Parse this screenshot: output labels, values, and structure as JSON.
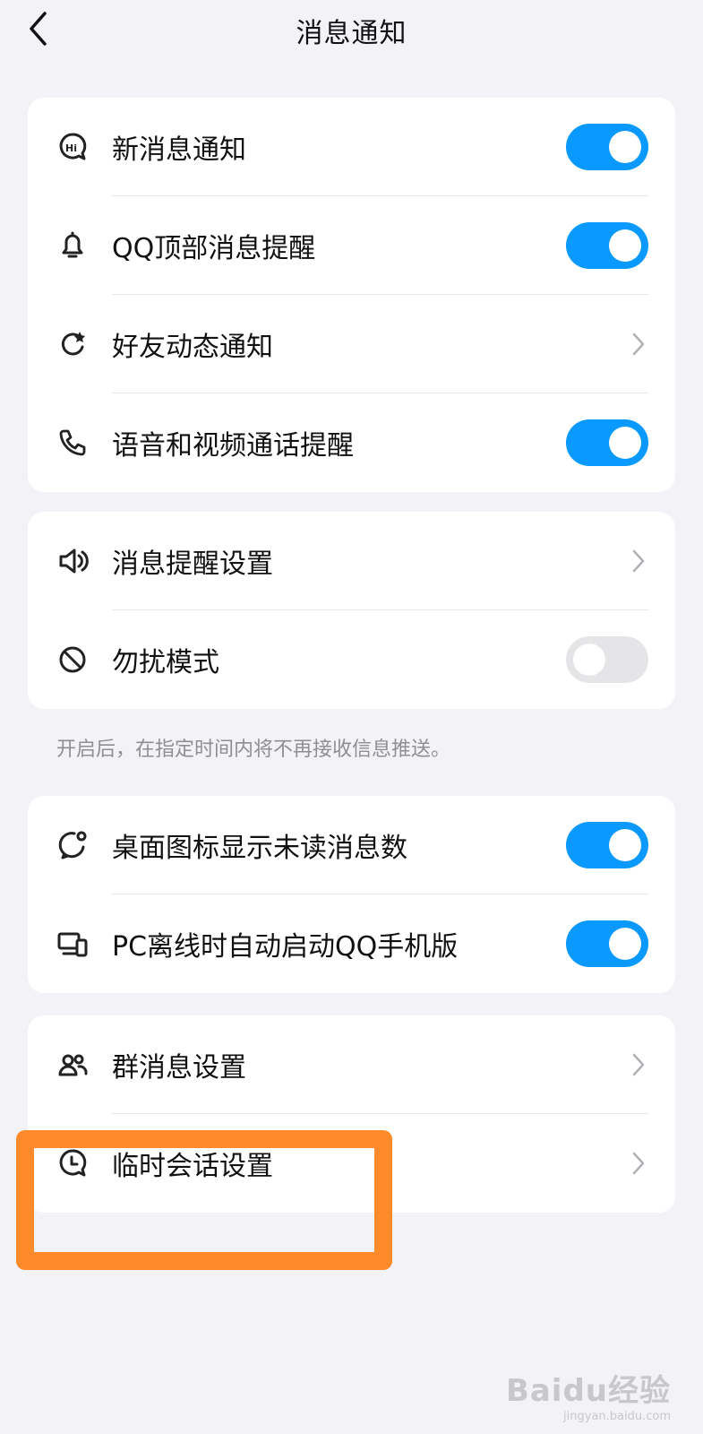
{
  "header": {
    "title": "消息通知",
    "back_icon": "chevron-left-icon"
  },
  "colors": {
    "accent": "#0a99ff",
    "background": "#f2f2f7",
    "highlight": "#ff8a2b",
    "toggle_off": "#e5e5e8"
  },
  "group1": [
    {
      "label": "新消息通知",
      "icon": "hi-bubble-icon",
      "control": "toggle",
      "on": true
    },
    {
      "label": "QQ顶部消息提醒",
      "icon": "bell-icon",
      "control": "toggle",
      "on": true
    },
    {
      "label": "好友动态通知",
      "icon": "refresh-star-icon",
      "control": "chevron"
    },
    {
      "label": "语音和视频通话提醒",
      "icon": "phone-icon",
      "control": "toggle",
      "on": true
    }
  ],
  "group2": [
    {
      "label": "消息提醒设置",
      "icon": "speaker-icon",
      "control": "chevron"
    },
    {
      "label": "勿扰模式",
      "icon": "no-disturb-icon",
      "control": "toggle",
      "on": false
    }
  ],
  "group2_hint": "开启后，在指定时间内将不再接收信息推送。",
  "group3": [
    {
      "label": "桌面图标显示未读消息数",
      "icon": "badge-bubble-icon",
      "control": "toggle",
      "on": true
    },
    {
      "label": "PC离线时自动启动QQ手机版",
      "icon": "devices-icon",
      "control": "toggle",
      "on": true
    }
  ],
  "group4": [
    {
      "label": "群消息设置",
      "icon": "group-icon",
      "control": "chevron"
    },
    {
      "label": "临时会话设置",
      "icon": "clock-bubble-icon",
      "control": "chevron"
    }
  ],
  "watermark": {
    "logo": "Baidu经验",
    "url": "jingyan.baidu.com"
  }
}
